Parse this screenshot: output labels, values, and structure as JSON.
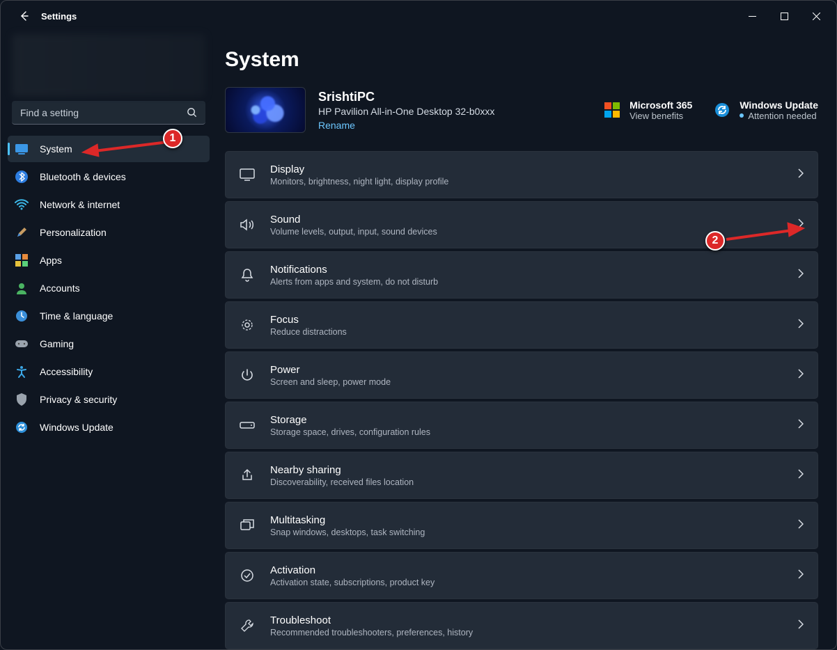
{
  "window": {
    "title": "Settings"
  },
  "search": {
    "placeholder": "Find a setting"
  },
  "sidebar": {
    "items": [
      {
        "id": "system",
        "label": "System"
      },
      {
        "id": "bluetooth",
        "label": "Bluetooth & devices"
      },
      {
        "id": "network",
        "label": "Network & internet"
      },
      {
        "id": "personalization",
        "label": "Personalization"
      },
      {
        "id": "apps",
        "label": "Apps"
      },
      {
        "id": "accounts",
        "label": "Accounts"
      },
      {
        "id": "time",
        "label": "Time & language"
      },
      {
        "id": "gaming",
        "label": "Gaming"
      },
      {
        "id": "accessibility",
        "label": "Accessibility"
      },
      {
        "id": "privacy",
        "label": "Privacy & security"
      },
      {
        "id": "update",
        "label": "Windows Update"
      }
    ]
  },
  "main": {
    "heading": "System",
    "device": {
      "name": "SrishtiPC",
      "model": "HP Pavilion All-in-One Desktop 32-b0xxx",
      "rename_label": "Rename"
    },
    "promo": {
      "m365": {
        "title": "Microsoft 365",
        "sub": "View benefits"
      },
      "update": {
        "title": "Windows Update",
        "sub": "Attention needed"
      }
    },
    "settings": [
      {
        "id": "display",
        "title": "Display",
        "sub": "Monitors, brightness, night light, display profile"
      },
      {
        "id": "sound",
        "title": "Sound",
        "sub": "Volume levels, output, input, sound devices"
      },
      {
        "id": "notifications",
        "title": "Notifications",
        "sub": "Alerts from apps and system, do not disturb"
      },
      {
        "id": "focus",
        "title": "Focus",
        "sub": "Reduce distractions"
      },
      {
        "id": "power",
        "title": "Power",
        "sub": "Screen and sleep, power mode"
      },
      {
        "id": "storage",
        "title": "Storage",
        "sub": "Storage space, drives, configuration rules"
      },
      {
        "id": "nearby",
        "title": "Nearby sharing",
        "sub": "Discoverability, received files location"
      },
      {
        "id": "multitasking",
        "title": "Multitasking",
        "sub": "Snap windows, desktops, task switching"
      },
      {
        "id": "activation",
        "title": "Activation",
        "sub": "Activation state, subscriptions, product key"
      },
      {
        "id": "troubleshoot",
        "title": "Troubleshoot",
        "sub": "Recommended troubleshooters, preferences, history"
      }
    ]
  },
  "annotations": {
    "marker1": "1",
    "marker2": "2"
  }
}
